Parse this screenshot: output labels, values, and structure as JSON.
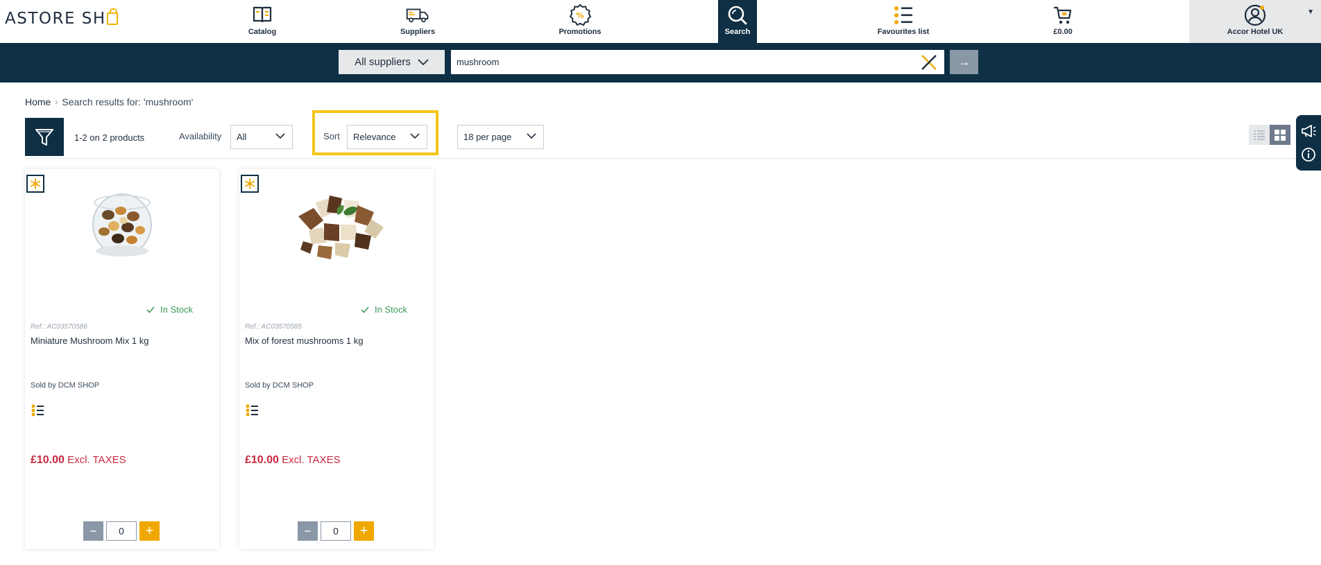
{
  "brand": {
    "logo_text_before": "ASTORE SH",
    "logo_text_after": "P"
  },
  "nav": {
    "catalog": "Catalog",
    "suppliers": "Suppliers",
    "promotions": "Promotions",
    "search": "Search",
    "favourites": "Favourites list",
    "cart_total": "£0.00",
    "account": "Accor Hotel UK"
  },
  "search": {
    "supplier_select": "All suppliers",
    "query": "mushroom",
    "placeholder": "",
    "go_label": "→"
  },
  "breadcrumb": {
    "home": "Home",
    "current": "Search results for: 'mushroom'"
  },
  "toolbar": {
    "count": "1-2 on 2 products",
    "availability_label": "Availability",
    "availability_value": "All",
    "sort_label": "Sort",
    "sort_value": "Relevance",
    "per_page_value": "18 per page"
  },
  "products": [
    {
      "ref": "Ref.: AC03570586",
      "name": "Miniature Mushroom Mix 1 kg",
      "stock": "In Stock",
      "seller": "Sold by DCM SHOP",
      "price": "£10.00",
      "price_suffix": "Excl. TAXES",
      "quantity": "0"
    },
    {
      "ref": "Ref.: AC03570585",
      "name": "Mix of forest mushrooms 1 kg",
      "stock": "In Stock",
      "seller": "Sold by DCM SHOP",
      "price": "£10.00",
      "price_suffix": "Excl. TAXES",
      "quantity": "0"
    }
  ],
  "colors": {
    "navy": "#0e2f44",
    "accent_yellow": "#f0a800",
    "highlight": "#f5c518",
    "price_red": "#c8283f",
    "stock_green": "#3d9a58"
  }
}
